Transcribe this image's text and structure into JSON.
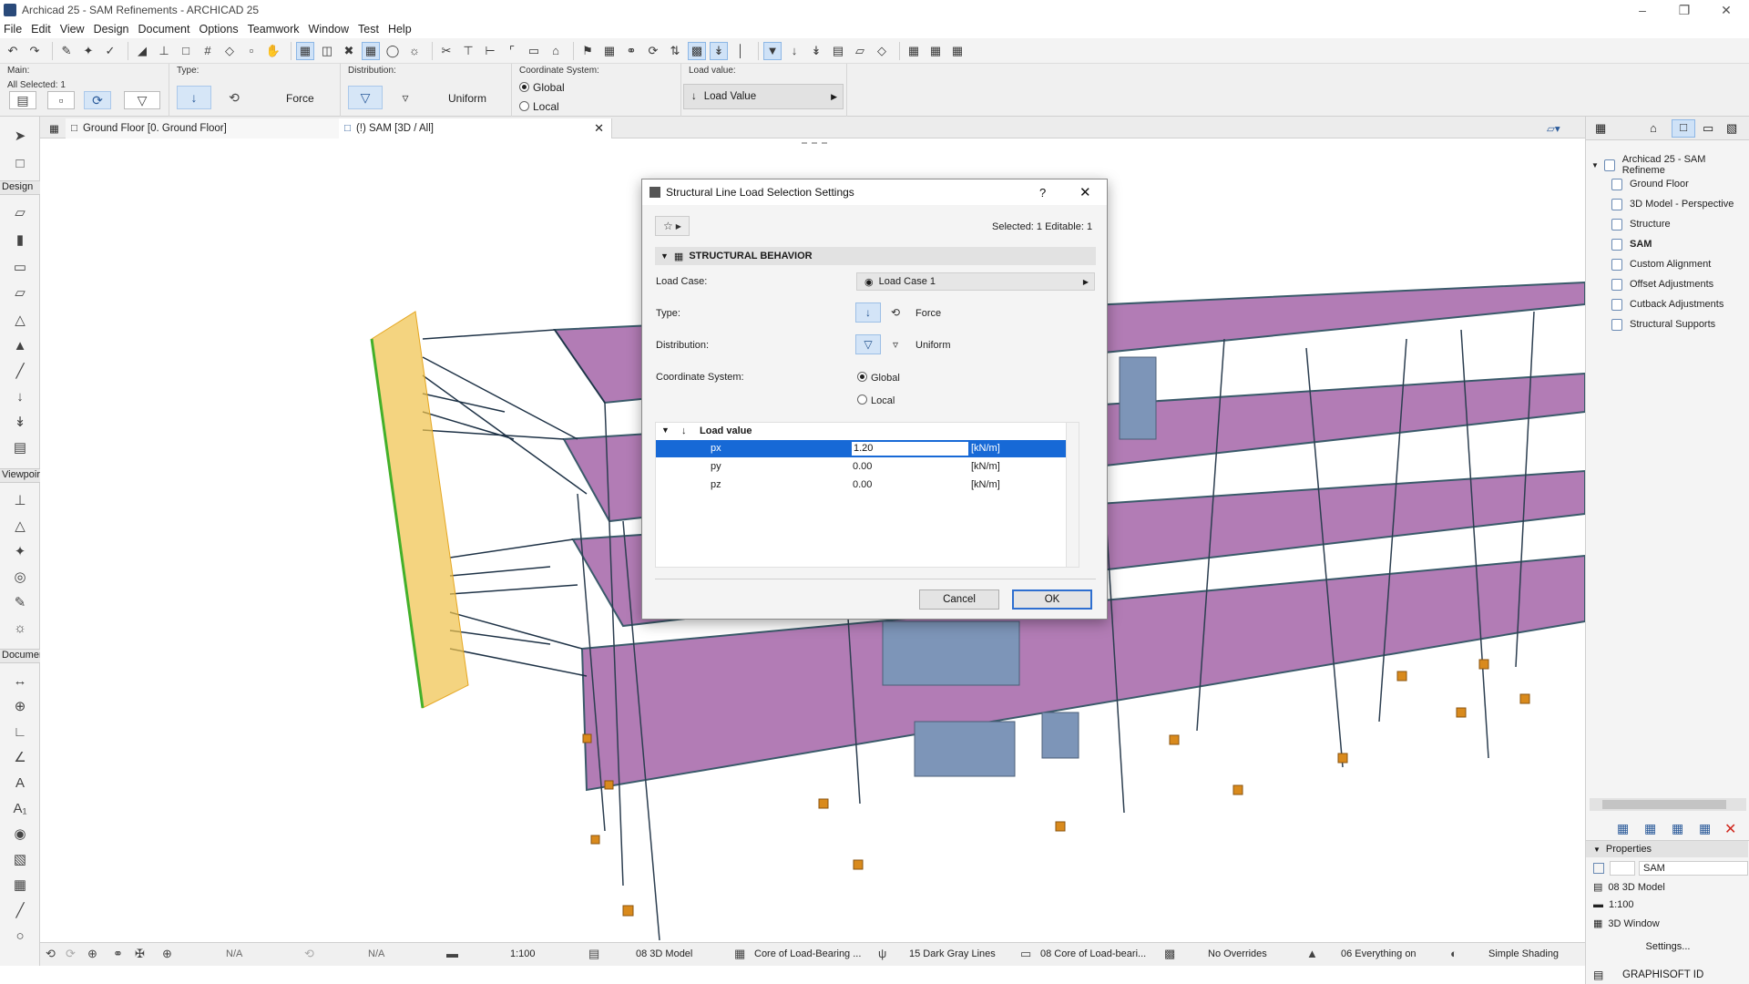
{
  "window": {
    "title": "Archicad 25 - SAM Refinements - ARCHICAD 25",
    "controls": [
      "minimize-icon",
      "restore-icon",
      "close-icon"
    ]
  },
  "menu": [
    "File",
    "Edit",
    "View",
    "Design",
    "Document",
    "Options",
    "Teamwork",
    "Window",
    "Test",
    "Help"
  ],
  "infobox": {
    "main_label": "Main:",
    "all_selected": "All Selected: 1",
    "type_label": "Type:",
    "type_value": "Force",
    "distribution_label": "Distribution:",
    "distribution_value": "Uniform",
    "coord_label": "Coordinate System:",
    "coord_global": "Global",
    "coord_local": "Local",
    "load_value_label": "Load value:",
    "load_value_button": "Load Value"
  },
  "toolbox": {
    "sections": [
      "Design",
      "Viewpoir",
      "Documer"
    ]
  },
  "tabs": [
    {
      "label": "Ground Floor [0. Ground Floor]"
    },
    {
      "label": "(!) SAM [3D / All]"
    }
  ],
  "dialog": {
    "title": "Structural Line Load Selection Settings",
    "help": "?",
    "selected_info": "Selected: 1 Editable: 1",
    "section": "STRUCTURAL BEHAVIOR",
    "load_case_label": "Load Case:",
    "load_case_value": "Load Case 1",
    "type_label": "Type:",
    "type_value": "Force",
    "distribution_label": "Distribution:",
    "distribution_value": "Uniform",
    "coord_label": "Coordinate System:",
    "coord_global": "Global",
    "coord_local": "Local",
    "load_value_header": "Load value",
    "rows": [
      {
        "name": "px",
        "value": "1.20",
        "unit": "[kN/m]"
      },
      {
        "name": "py",
        "value": "0.00",
        "unit": "[kN/m]"
      },
      {
        "name": "pz",
        "value": "0.00",
        "unit": "[kN/m]"
      }
    ],
    "cancel": "Cancel",
    "ok": "OK"
  },
  "navigator": {
    "root": "Archicad 25 - SAM Refineme",
    "items": [
      "Ground Floor",
      "3D Model - Perspective",
      "Structure",
      "SAM",
      "Custom Alignment",
      "Offset Adjustments",
      "Cutback Adjustments",
      "Structural Supports"
    ],
    "active": "SAM"
  },
  "properties": {
    "header": "Properties",
    "name_value": "SAM",
    "layer": "08 3D Model",
    "scale": "1:100",
    "window": "3D Window",
    "settings": "Settings..."
  },
  "statusbar": {
    "na1": "N/A",
    "na2": "N/A",
    "scale": "1:100",
    "layer_combo": "08 3D Model",
    "structural_function": "Core of Load-Bearing ...",
    "pen_set": "15 Dark Gray Lines",
    "model_view": "08 Core of Load-beari...",
    "overrides": "No Overrides",
    "renovation": "06 Everything on",
    "shading": "Simple Shading"
  },
  "footer": {
    "graphisoft_id": "GRAPHISOFT ID"
  },
  "colors": {
    "slab": "#9a5aa0",
    "selection": "#1769d6",
    "accent_blue": "#cfe2f7",
    "support": "#d98a1c"
  }
}
